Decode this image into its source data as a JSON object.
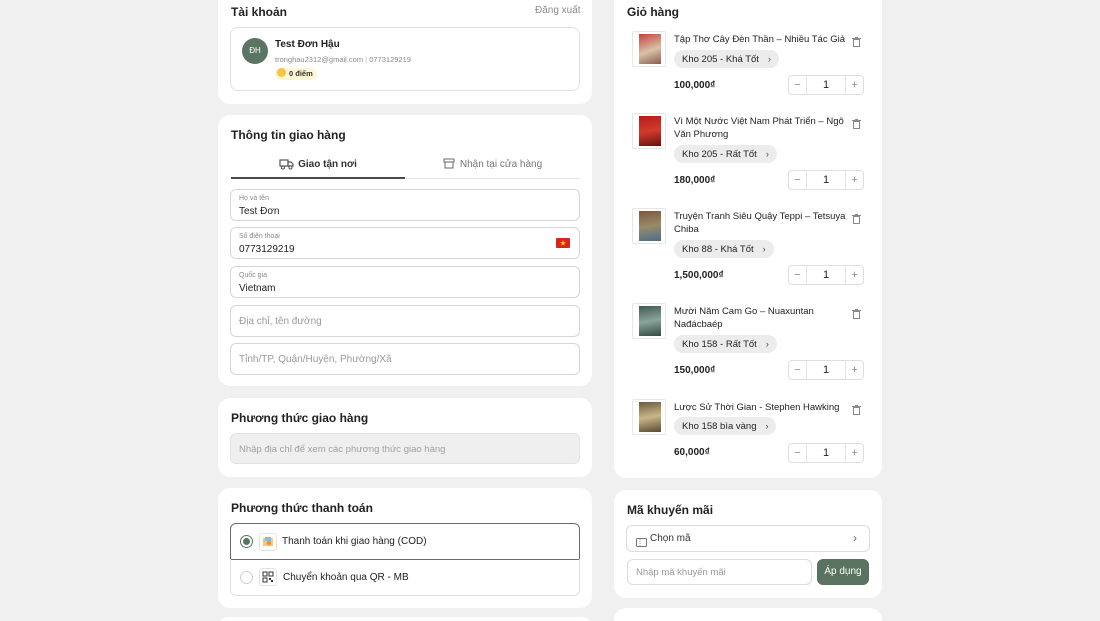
{
  "account": {
    "title": "Tài khoản",
    "logout": "Đăng xuất",
    "avatar_initials": "ĐH",
    "name": "Test Đơn Hậu",
    "email": "tronghau2312@gmail.com",
    "phone": "0773129219",
    "points": "0 điểm"
  },
  "shipping_info": {
    "title": "Thông tin giao hàng",
    "tabs": [
      {
        "label": "Giao tận nơi",
        "active": true,
        "icon": "truck-icon"
      },
      {
        "label": "Nhận tại cửa hàng",
        "active": false,
        "icon": "store-icon"
      }
    ],
    "fields": {
      "name": {
        "label": "Họ và tên",
        "value": "Test Đơn"
      },
      "phone": {
        "label": "Số điện thoại",
        "value": "0773129219"
      },
      "country": {
        "label": "Quốc gia",
        "value": "Vietnam"
      },
      "address": {
        "placeholder": "Địa chỉ, tên đường"
      },
      "region": {
        "placeholder": "Tỉnh/TP, Quận/Huyện, Phường/Xã"
      }
    }
  },
  "shipping_method": {
    "title": "Phương thức giao hàng",
    "placeholder": "Nhập địa chỉ để xem các phương thức giao hàng"
  },
  "payment": {
    "title": "Phương thức thanh toán",
    "options": [
      {
        "label": "Thanh toán khi giao hàng (COD)",
        "selected": true,
        "icon": "cash-icon"
      },
      {
        "label": "Chuyển khoản qua QR - MB",
        "selected": false,
        "icon": "qr-code-icon"
      }
    ]
  },
  "cart": {
    "title": "Giỏ hàng",
    "items": [
      {
        "name": "Tập Thơ Cây Đèn Thần – Nhiều Tác Giả",
        "variant": "Kho 205 - Khá Tốt",
        "price": "100,000₫",
        "qty": "1"
      },
      {
        "name": "Vì Một Nước Việt Nam Phát Triển – Ngô Văn Phương",
        "variant": "Kho 205 - Rất Tốt",
        "price": "180,000₫",
        "qty": "1"
      },
      {
        "name": "Truyện Tranh Siêu Quậy Teppi – Tetsuya Chiba",
        "variant": "Kho 88 - Khá Tốt",
        "price": "1,500,000₫",
        "qty": "1"
      },
      {
        "name": "Mười Năm Cam Go – Nuaxuntan Nađácbaép",
        "variant": "Kho 158 - Rất Tốt",
        "price": "150,000₫",
        "qty": "1"
      },
      {
        "name": "Lược Sử Thời Gian - Stephen Hawking",
        "variant": "Kho 158 bìa vàng",
        "price": "60,000₫",
        "qty": "1"
      }
    ]
  },
  "promo": {
    "title": "Mã khuyến mãi",
    "select_label": "Chọn mã",
    "input_placeholder": "Nhập mã khuyến mãi",
    "apply_label": "Áp dụng"
  },
  "colors": {
    "page_bg": "#f0f0f0",
    "accent_green": "#5a7361",
    "text": "#1f1f1f",
    "points_badge": "#fff6d6"
  }
}
